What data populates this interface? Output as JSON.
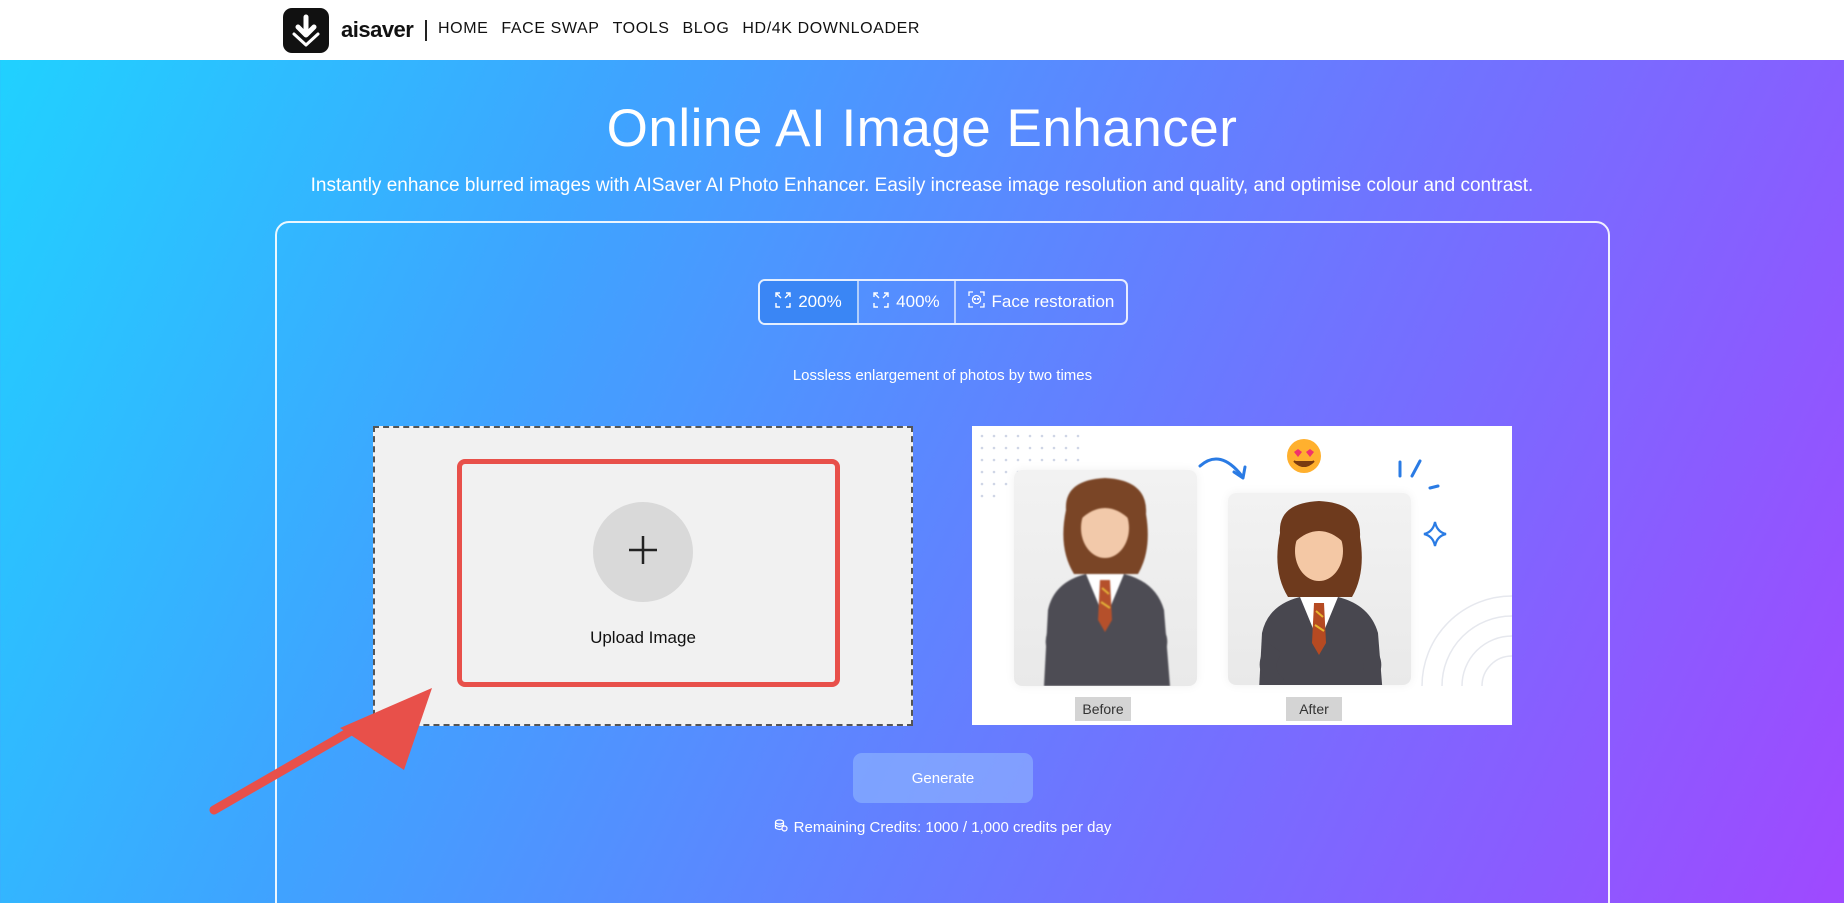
{
  "header": {
    "brand": "aisaver",
    "nav": [
      "HOME",
      "FACE SWAP",
      "TOOLS",
      "BLOG",
      "HD/4K DOWNLOADER"
    ]
  },
  "hero": {
    "title": "Online AI Image Enhancer",
    "subtitle": "Instantly enhance blurred images with AISaver AI Photo Enhancer. Easily increase image resolution and quality, and optimise colour and contrast."
  },
  "modes": {
    "items": [
      {
        "label": "200%",
        "icon": "expand-icon",
        "active": true
      },
      {
        "label": "400%",
        "icon": "expand-icon",
        "active": false
      },
      {
        "label": "Face restoration",
        "icon": "face-scan-icon",
        "active": false
      }
    ],
    "description": "Lossless enlargement of photos by two times"
  },
  "upload": {
    "label": "Upload Image",
    "icon": "plus-icon"
  },
  "sample": {
    "before_label": "Before",
    "after_label": "After"
  },
  "actions": {
    "generate_label": "Generate",
    "credits_text": "Remaining Credits:  1000 / 1,000 credits per day"
  },
  "colors": {
    "accent": "#3a86f5",
    "highlight": "#e8504a",
    "gradient_start": "#1fd3ff",
    "gradient_end": "#9f49ff"
  }
}
